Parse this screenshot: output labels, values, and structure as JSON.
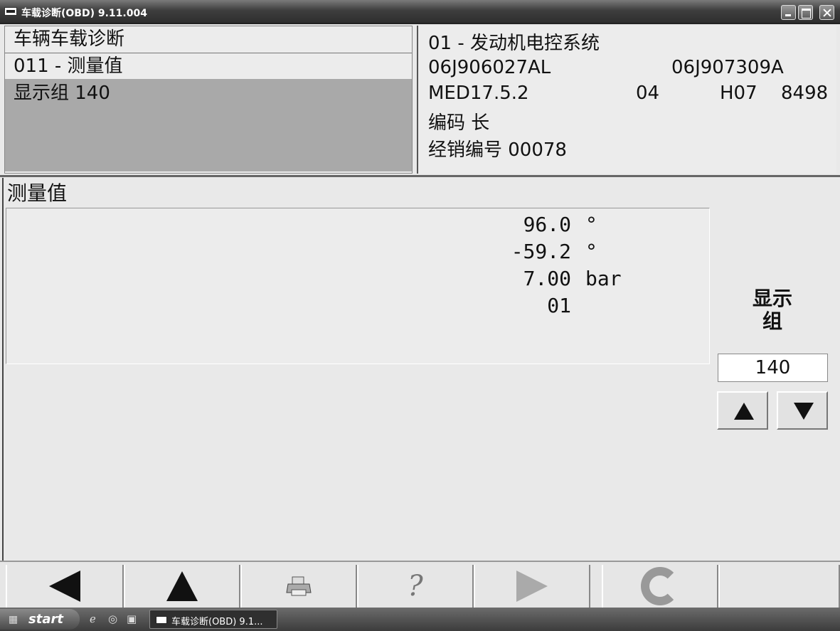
{
  "window": {
    "title": "车载诊断(OBD) 9.11.004"
  },
  "header_left": {
    "line1": "车辆车载诊断",
    "line2": "011 - 测量值",
    "line3": "显示组 140"
  },
  "header_right": {
    "system": "01 - 发动机电控系统",
    "part_no_1": "06J906027AL",
    "part_no_2": "06J907309A",
    "ecu": "MED17.5.2",
    "ecu_num": "04",
    "ecu_ver": "H07",
    "ecu_code": "8498",
    "coding": "编码 长",
    "dealer": "经销编号 00078"
  },
  "section": {
    "title": "测量值"
  },
  "measurements": [
    {
      "value": "96.0",
      "unit": "°"
    },
    {
      "value": "-59.2",
      "unit": "°"
    },
    {
      "value": "7.00",
      "unit": "bar"
    },
    {
      "value": "01",
      "unit": ""
    }
  ],
  "group_control": {
    "label_line1": "显示",
    "label_line2": "组",
    "value": "140"
  },
  "toolbar": {
    "buttons": [
      "back-icon",
      "up-icon",
      "printer-icon",
      "help-icon",
      "forward-icon",
      "refresh-icon"
    ]
  },
  "taskbar": {
    "start_label": "start",
    "task_label": "车载诊断(OBD) 9.1..."
  }
}
